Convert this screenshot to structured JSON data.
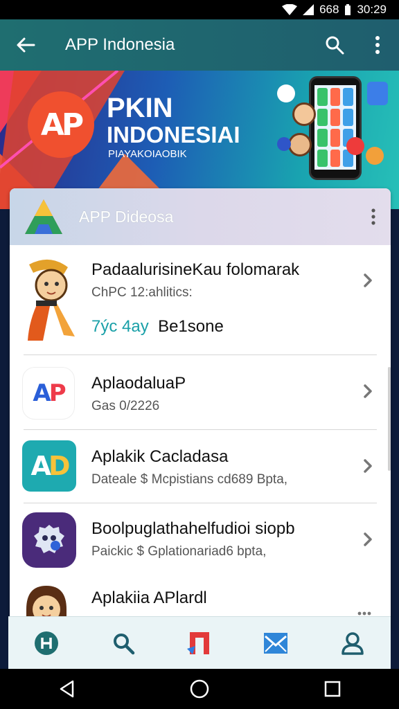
{
  "status_bar": {
    "battery": "668",
    "time": "30:29"
  },
  "app_bar": {
    "title": "APP Indonesia",
    "back_icon": "arrow-left-icon",
    "search_icon": "search-icon",
    "more_icon": "more-vert-icon"
  },
  "hero": {
    "logo_text": "AP",
    "line1": "PKIN",
    "line2": "INDONESIAI",
    "line3": "PIAYAKOIAOBIK"
  },
  "card": {
    "title": "APP Dideosa",
    "items": [
      {
        "title": "PadaalurisineKau folomarak",
        "subtitle": "ChPC 12:ahlitics:",
        "extra_teal": "7ýc 4ay",
        "extra_dark": "Be1sone"
      },
      {
        "title": "AplaodaluaP",
        "subtitle": "Gas 0/2226"
      },
      {
        "title": "Aplakik Cacladasa",
        "subtitle": "Dateale $   Mcpistians cd689 Bpta,"
      },
      {
        "title": "Boolpuglathahelfudioi siopb",
        "subtitle": "Paickic $   Gplationariad6 bpta,"
      },
      {
        "title": "Aplakiia APlardl",
        "subtitle": ""
      }
    ]
  },
  "bottom_nav": [
    "home-icon",
    "search-icon",
    "store-icon",
    "mail-icon",
    "profile-icon"
  ],
  "colors": {
    "app_bar": "#1f6e70",
    "accent_teal": "#1aa0a8",
    "logo_orange": "#f0502f"
  }
}
